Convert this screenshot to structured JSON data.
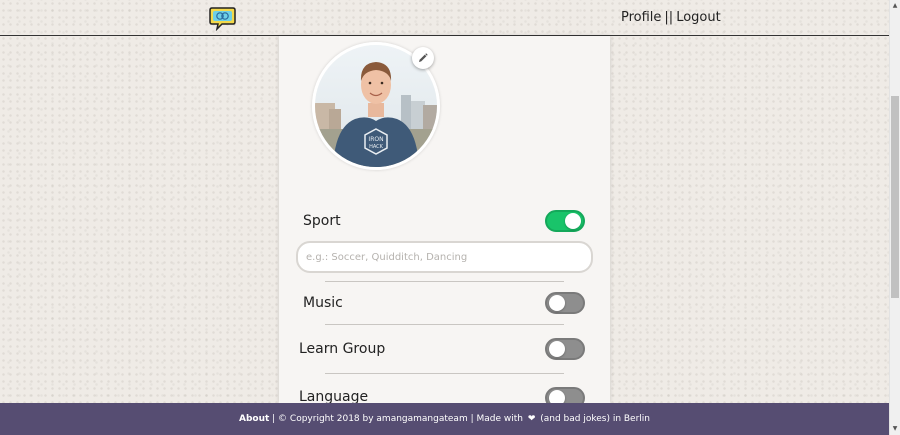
{
  "header": {
    "logo_icon": "chat-bubble-logo-icon",
    "nav": {
      "profile_label": "Profile",
      "separator": "||",
      "logout_label": "Logout"
    }
  },
  "profile": {
    "avatar_icon": "profile-photo",
    "edit_icon": "pencil-icon"
  },
  "interests": [
    {
      "label": "Sport",
      "enabled": true,
      "input_placeholder": "e.g.: Soccer, Quidditch, Dancing"
    },
    {
      "label": "Music",
      "enabled": false
    },
    {
      "label": "Learn Group",
      "enabled": false
    },
    {
      "label": "Language",
      "enabled": false
    }
  ],
  "footer": {
    "about_label": "About",
    "copyright_text": " | © Copyright 2018 by amangamangateam | Made with ",
    "heart_glyph": "❤",
    "closing_text": " (and bad jokes) in Berlin"
  },
  "colors": {
    "toggle_on": "#19c46a",
    "toggle_off": "#8e8e8e",
    "footer_bg": "#564d72",
    "page_bg": "#efebe6"
  }
}
